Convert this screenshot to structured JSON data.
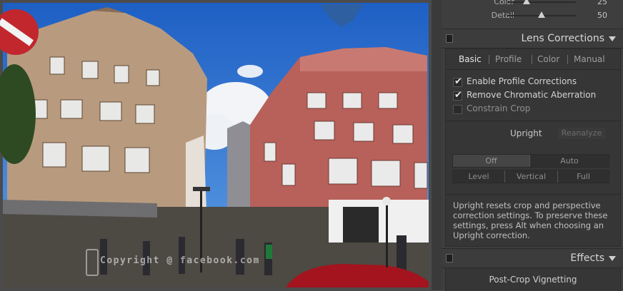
{
  "detail_panel": {
    "sliders": [
      {
        "label": "Color",
        "value": "25",
        "fraction": 0.25
      },
      {
        "label": "Detail",
        "value": "50",
        "fraction": 0.5
      }
    ]
  },
  "lens_corrections": {
    "title": "Lens Corrections",
    "tabs": [
      "Basic",
      "Profile",
      "Color",
      "Manual"
    ],
    "active_tab": "Basic",
    "checkboxes": [
      {
        "label": "Enable Profile Corrections",
        "checked": true
      },
      {
        "label": "Remove Chromatic Aberration",
        "checked": true
      },
      {
        "label": "Constrain Crop",
        "checked": false
      }
    ],
    "upright_label": "Upright",
    "reanalyze_label": "Reanalyze",
    "upright_buttons_row1": [
      "Off",
      "Auto"
    ],
    "upright_buttons_row2": [
      "Level",
      "Vertical",
      "Full"
    ],
    "description": "Upright resets crop and perspective correction settings. To preserve these settings, press Alt when choosing an Upright correction."
  },
  "effects": {
    "title": "Effects",
    "post_crop_vignetting": "Post-Crop Vignetting"
  },
  "photo": {
    "watermark": "Copyright @ facebook.com"
  },
  "colors": {
    "sky": "#2f7ad6",
    "panel_bg": "#3e3e3e",
    "text": "#d4d4d4"
  }
}
